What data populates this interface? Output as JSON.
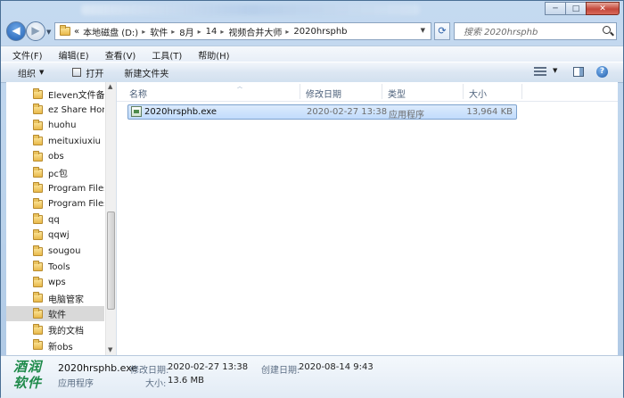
{
  "window": {
    "controls": {
      "minimize": "─",
      "maximize": "□",
      "close": "✕"
    }
  },
  "address": {
    "overflow": "«",
    "crumbs": [
      "本地磁盘 (D:)",
      "软件",
      "8月",
      "14",
      "视频合并大师",
      "2020hrsphb"
    ],
    "separator": "▸"
  },
  "search": {
    "placeholder": "搜索 2020hrsphb"
  },
  "menu": [
    "文件(F)",
    "编辑(E)",
    "查看(V)",
    "工具(T)",
    "帮助(H)"
  ],
  "toolbar": {
    "organize": "组织",
    "open": "打开",
    "new_folder": "新建文件夹"
  },
  "sidebar": {
    "items": [
      "Eleven文件备份",
      "ez Share Home",
      "huohu",
      "meituxiuxiu",
      "obs",
      "pc包",
      "Program Files",
      "Program Files",
      "qq",
      "qqwj",
      "sougou",
      "Tools",
      "wps",
      "电脑管家",
      "软件",
      "我的文档",
      "新obs"
    ],
    "selected_index": 14
  },
  "columns": {
    "name": "名称",
    "date": "修改日期",
    "type": "类型",
    "size": "大小"
  },
  "files": [
    {
      "name": "2020hrsphb.exe",
      "date": "2020-02-27 13:38",
      "type": "应用程序",
      "size": "13,964 KB"
    }
  ],
  "details": {
    "logo_text": "酒润软件",
    "name": "2020hrsphb.exe",
    "type": "应用程序",
    "modified_label": "修改日期:",
    "modified_value": "2020-02-27 13:38",
    "created_label": "创建日期:",
    "created_value": "2020-08-14 9:43",
    "size_label": "大小:",
    "size_value": "13.6 MB"
  },
  "colors": {
    "selection": "#c1dcfc",
    "title_bg": "#c5daf0",
    "close_button": "#c4473a"
  }
}
